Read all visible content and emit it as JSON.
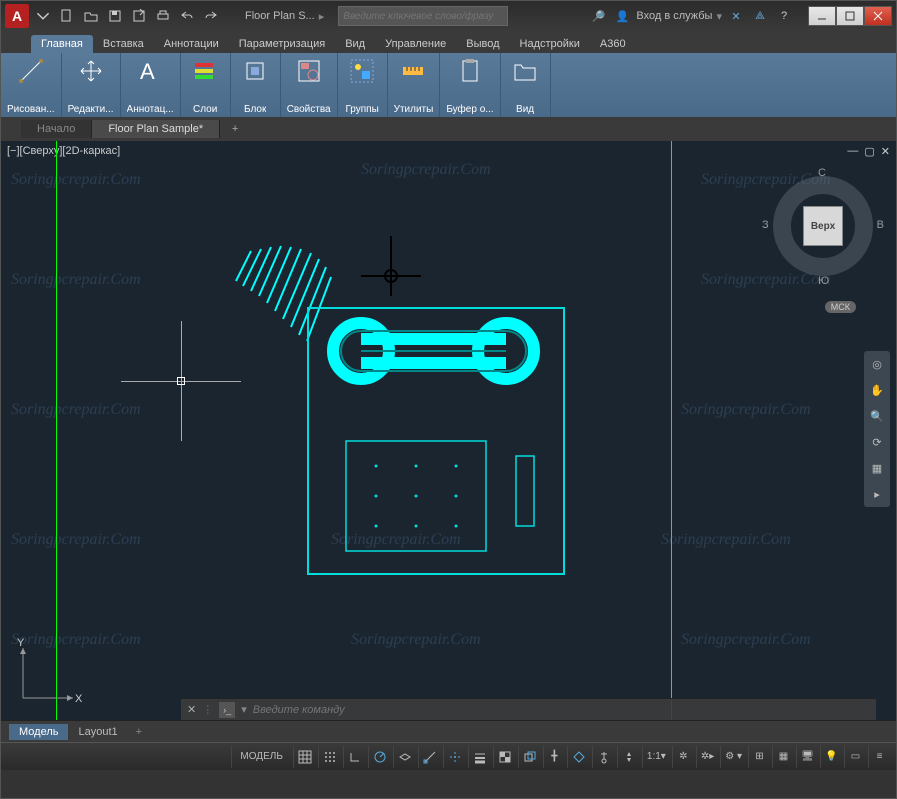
{
  "app": {
    "logo_letter": "A",
    "title": "Floor Plan S...",
    "search_placeholder": "Введите ключевое слово/фразу",
    "signin": "Вход в службы"
  },
  "ribbon": {
    "tabs": [
      "Главная",
      "Вставка",
      "Аннотации",
      "Параметризация",
      "Вид",
      "Управление",
      "Вывод",
      "Надстройки",
      "A360"
    ],
    "groups": [
      "Рисован...",
      "Редакти...",
      "Аннотац...",
      "Слои",
      "Блок",
      "Свойства",
      "Группы",
      "Утилиты",
      "Буфер о...",
      "Вид"
    ]
  },
  "doc_tabs": {
    "tab0": "Начало",
    "tab1": "Floor Plan Sample*"
  },
  "viewport": {
    "label": "[−][Сверху][2D-каркас]"
  },
  "viewcube": {
    "face": "Верх",
    "n": "С",
    "s": "Ю",
    "e": "В",
    "w": "З",
    "home": "МСК"
  },
  "ucs": {
    "x": "X",
    "y": "Y"
  },
  "cmdline": {
    "placeholder": "Введите команду"
  },
  "layout_tabs": {
    "model": "Модель",
    "l1": "Layout1"
  },
  "status": {
    "model": "МОДЕЛЬ",
    "scale": "1:1"
  }
}
